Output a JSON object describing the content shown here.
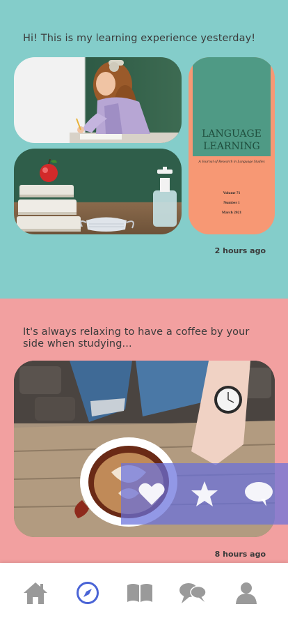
{
  "posts": [
    {
      "caption": "Hi! This is my learning experience yesterday!",
      "time": "2 hours ago",
      "journal": {
        "title_line1": "LANGUAGE",
        "title_line2": "LEARNING",
        "subtitle": "A Journal of Research in Language Studies",
        "volume": "Volume 71",
        "number": "Number 1",
        "date": "March 2021"
      }
    },
    {
      "caption": "It's always relaxing to have a coffee by your side when studying...",
      "time": "8 hours ago"
    }
  ],
  "actions": [
    "heart-icon",
    "star-icon",
    "comment-icon"
  ],
  "nav": {
    "items": [
      "home-icon",
      "compass-icon",
      "book-icon",
      "chat-icon",
      "profile-icon"
    ],
    "active": "compass-icon",
    "active_color": "#4a64d6",
    "inactive_color": "#9a9a9a"
  },
  "colors": {
    "post1_bg": "#84cdca",
    "post2_bg": "#f2a0a0",
    "action_bar": "#6870dc"
  }
}
